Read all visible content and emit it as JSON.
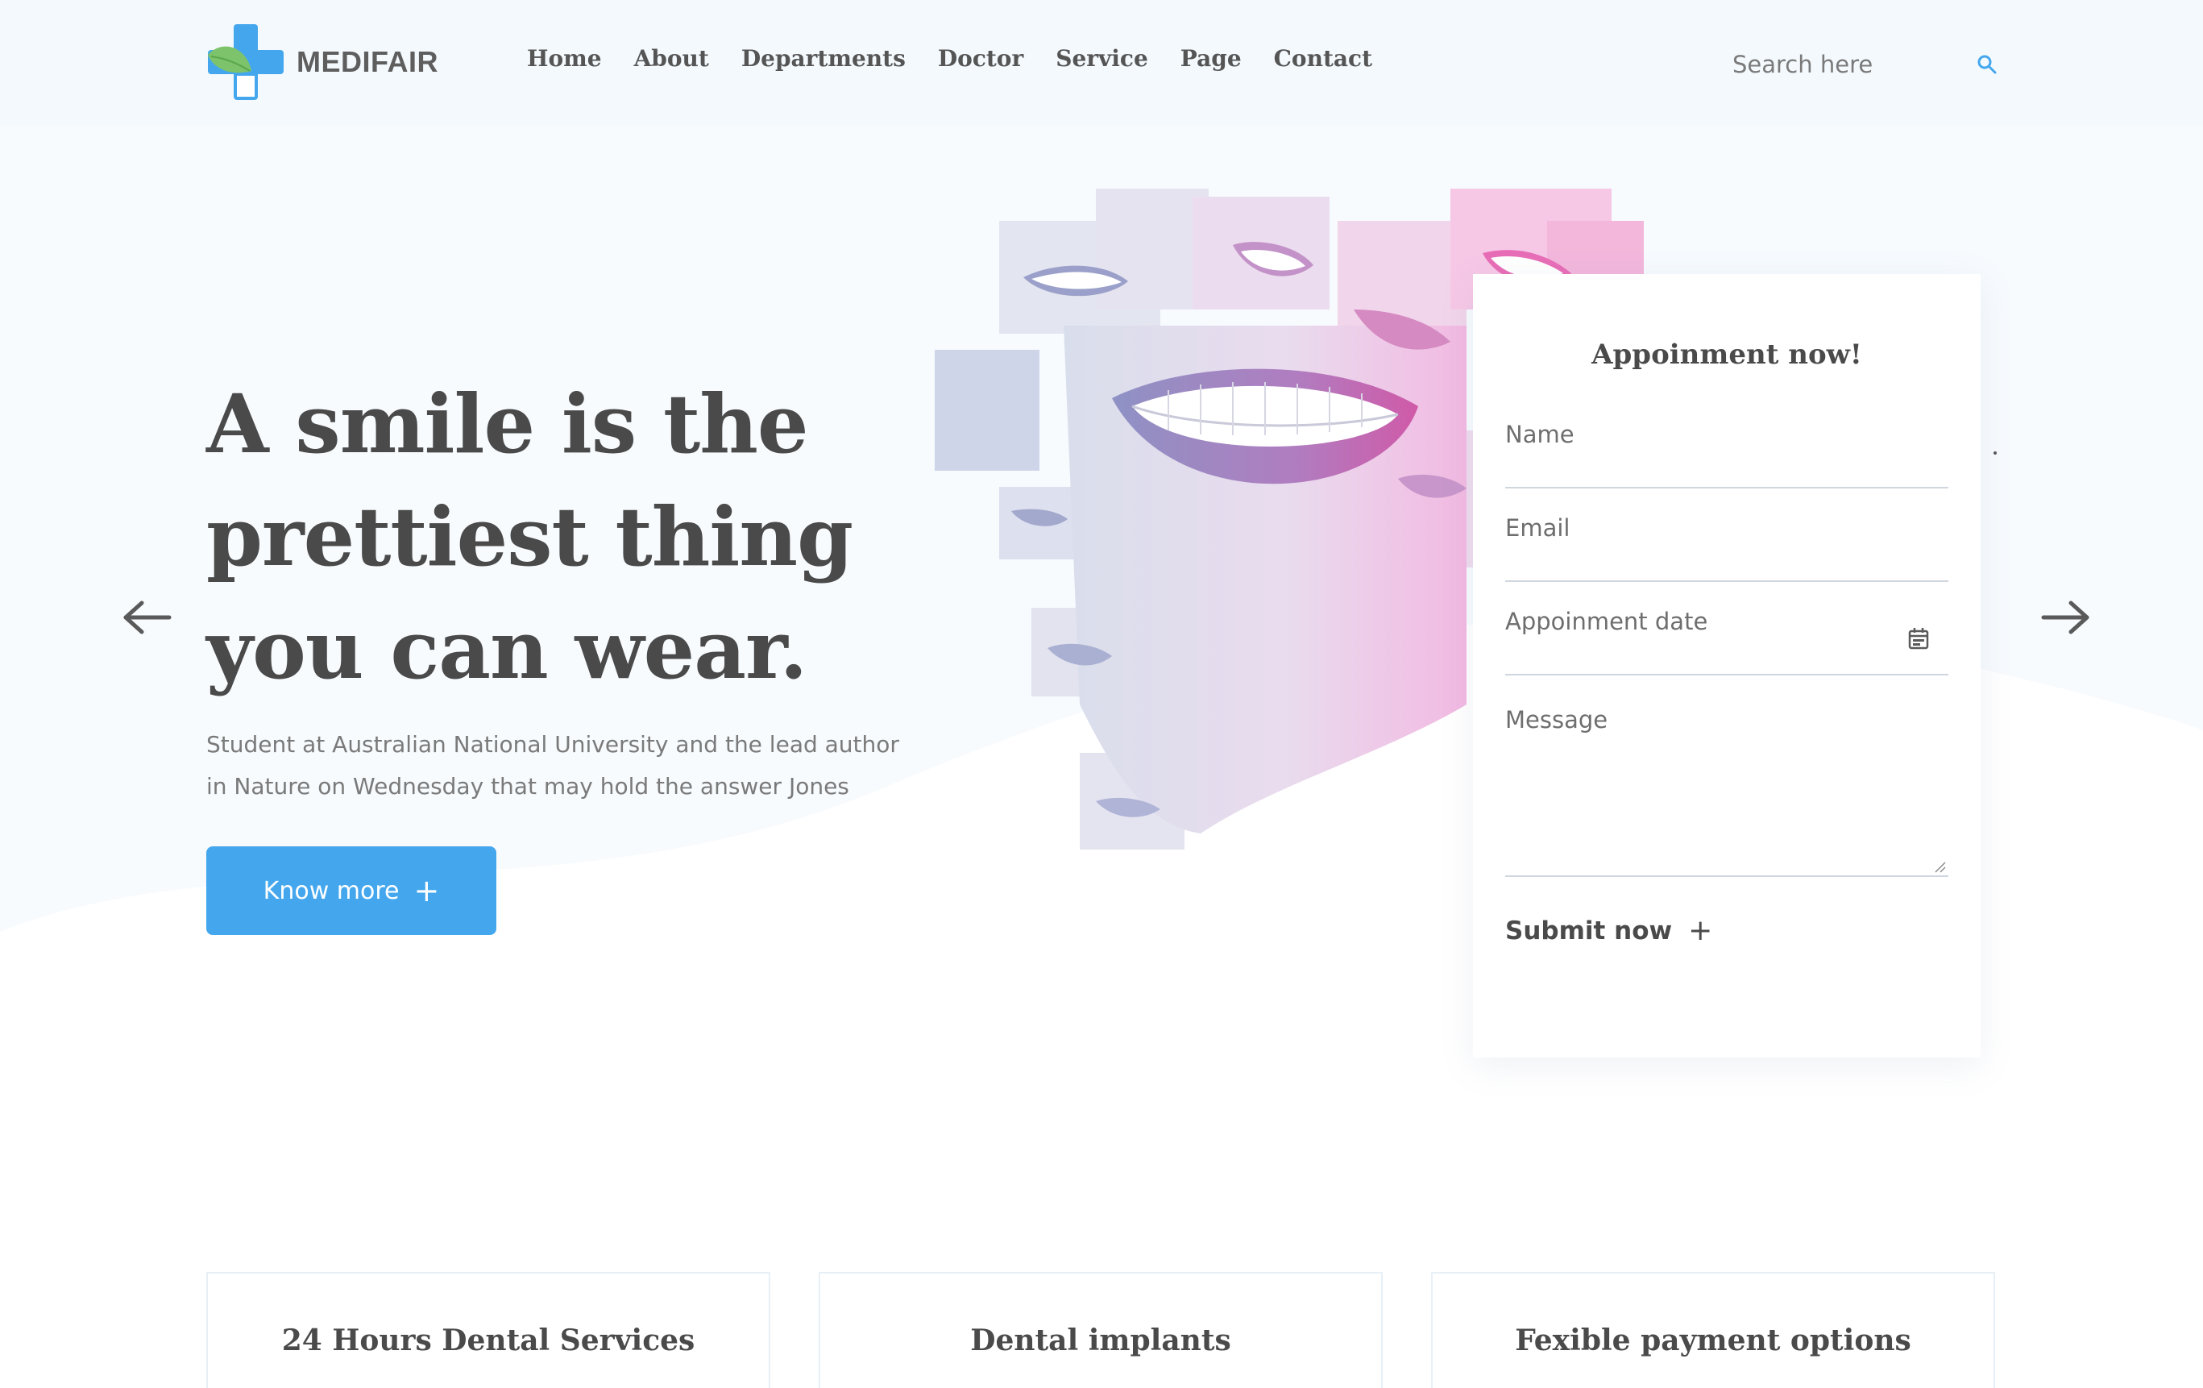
{
  "brand": {
    "name": "MEDIFAIR",
    "logo_icon": "medical-cross-leaf-icon",
    "accent_color": "#44a7ee",
    "leaf_color": "#7cc36b"
  },
  "nav": {
    "items": [
      {
        "label": "Home"
      },
      {
        "label": "About"
      },
      {
        "label": "Departments"
      },
      {
        "label": "Doctor"
      },
      {
        "label": "Service"
      },
      {
        "label": "Page"
      },
      {
        "label": "Contact"
      }
    ]
  },
  "search": {
    "placeholder": "Search here",
    "icon": "search-icon"
  },
  "hero": {
    "title_lines": [
      "A smile is the",
      "prettiest thing",
      "you can wear."
    ],
    "subtitle_lines": [
      "Student at Australian National University and the lead author",
      "in Nature on Wednesday that may hold the answer Jones"
    ],
    "cta_label": "Know more",
    "cta_icon": "plus-icon",
    "prev_icon": "arrow-left-icon",
    "next_icon": "arrow-right-icon"
  },
  "appointment": {
    "title": "Appoinment now!",
    "name_placeholder": "Name",
    "email_placeholder": "Email",
    "date_placeholder": "Appoinment date",
    "date_icon": "calendar-icon",
    "message_placeholder": "Message",
    "submit_label": "Submit now",
    "submit_icon": "plus-icon"
  },
  "features": {
    "cards": [
      {
        "title": "24 Hours Dental Services"
      },
      {
        "title": "Dental implants"
      },
      {
        "title": "Fexible payment options"
      }
    ]
  }
}
